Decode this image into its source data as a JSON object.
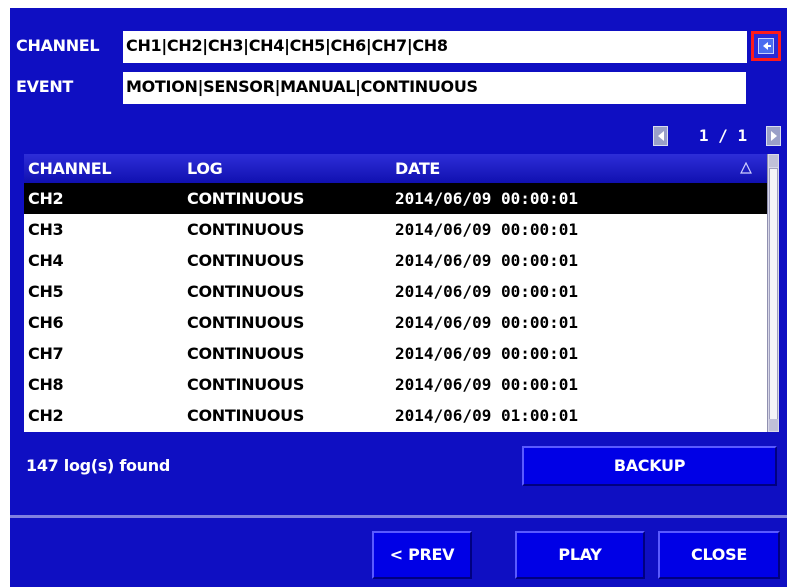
{
  "filters": {
    "channel_label": "CHANNEL",
    "channel_value": "CH1|CH2|CH3|CH4|CH5|CH6|CH7|CH8",
    "event_label": "EVENT",
    "event_value": "MOTION|SENSOR|MANUAL|CONTINUOUS",
    "channel_select_icon": "channel-select-icon"
  },
  "pagination": {
    "current": "1",
    "separator": "/",
    "total": "1",
    "text": "1 / 1"
  },
  "table": {
    "headers": [
      "CHANNEL",
      "LOG",
      "DATE"
    ],
    "sort_icon": "sort-triangle-icon",
    "rows": [
      {
        "channel": "CH2",
        "log": "CONTINUOUS",
        "date": "2014/06/09 00:00:01",
        "selected": true
      },
      {
        "channel": "CH3",
        "log": "CONTINUOUS",
        "date": "2014/06/09 00:00:01"
      },
      {
        "channel": "CH4",
        "log": "CONTINUOUS",
        "date": "2014/06/09 00:00:01"
      },
      {
        "channel": "CH5",
        "log": "CONTINUOUS",
        "date": "2014/06/09 00:00:01"
      },
      {
        "channel": "CH6",
        "log": "CONTINUOUS",
        "date": "2014/06/09 00:00:01"
      },
      {
        "channel": "CH7",
        "log": "CONTINUOUS",
        "date": "2014/06/09 00:00:01"
      },
      {
        "channel": "CH8",
        "log": "CONTINUOUS",
        "date": "2014/06/09 00:00:01"
      },
      {
        "channel": "CH2",
        "log": "CONTINUOUS",
        "date": "2014/06/09 01:00:01"
      }
    ]
  },
  "status": {
    "log_count": "147 log(s) found"
  },
  "buttons": {
    "backup": "BACKUP",
    "prev": "< PREV",
    "play": "PLAY",
    "close": "CLOSE"
  },
  "colors": {
    "panel": "#0f0fc2",
    "highlight": "#ff1a1a",
    "button": "#0000e6",
    "selected_row": "#000000"
  }
}
